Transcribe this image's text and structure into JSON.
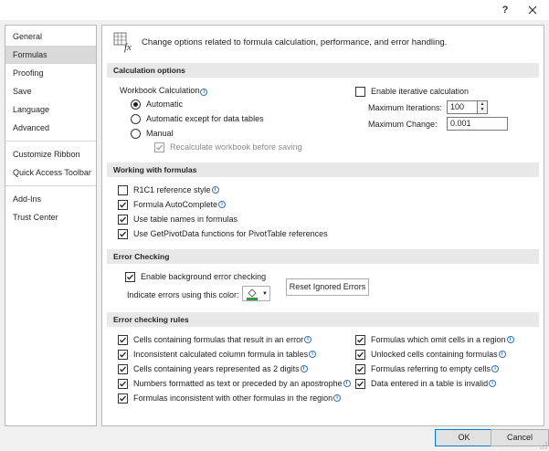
{
  "titlebar": {
    "help": "?"
  },
  "sidebar": {
    "groups": [
      [
        "General",
        "Formulas",
        "Proofing",
        "Save",
        "Language",
        "Advanced"
      ],
      [
        "Customize Ribbon",
        "Quick Access Toolbar"
      ],
      [
        "Add-Ins",
        "Trust Center"
      ]
    ],
    "selected": "Formulas"
  },
  "header": {
    "text": "Change options related to formula calculation, performance, and error handling."
  },
  "calc": {
    "title": "Calculation options",
    "workbook_label": "Workbook Calculation",
    "automatic": "Automatic",
    "automatic_except": "Automatic except for data tables",
    "manual": "Manual",
    "recalc": "Recalculate workbook before saving",
    "iterative": "Enable iterative calculation",
    "max_iter_label": "Maximum Iterations:",
    "max_iter_value": "100",
    "max_change_label": "Maximum Change:",
    "max_change_value": "0.001",
    "selected_mode": "automatic"
  },
  "working": {
    "title": "Working with formulas",
    "items": [
      {
        "label": "R1C1 reference style",
        "checked": false,
        "info": true
      },
      {
        "label": "Formula AutoComplete",
        "checked": true,
        "info": true
      },
      {
        "label": "Use table names in formulas",
        "checked": true,
        "info": false
      },
      {
        "label": "Use GetPivotData functions for PivotTable references",
        "checked": true,
        "info": false
      }
    ]
  },
  "error_checking": {
    "title": "Error Checking",
    "enable": "Enable background error checking",
    "indicate": "Indicate errors using this color:",
    "reset": "Reset Ignored Errors",
    "color": "#2e9a3b"
  },
  "rules": {
    "title": "Error checking rules",
    "left": [
      "Cells containing formulas that result in an error",
      "Inconsistent calculated column formula in tables",
      "Cells containing years represented as 2 digits",
      "Numbers formatted as text or preceded by an apostrophe",
      "Formulas inconsistent with other formulas in the region"
    ],
    "right": [
      "Formulas which omit cells in a region",
      "Unlocked cells containing formulas",
      "Formulas referring to empty cells",
      "Data entered in a table is invalid"
    ],
    "left_info": [
      true,
      true,
      true,
      true,
      true
    ],
    "right_info": [
      true,
      true,
      true,
      true
    ]
  },
  "buttons": {
    "ok": "OK",
    "cancel": "Cancel"
  },
  "colors": {
    "accent": "#0078d7",
    "info": "#2f73c4",
    "section": "#e8e8e8",
    "selected": "#d9d9d9"
  }
}
